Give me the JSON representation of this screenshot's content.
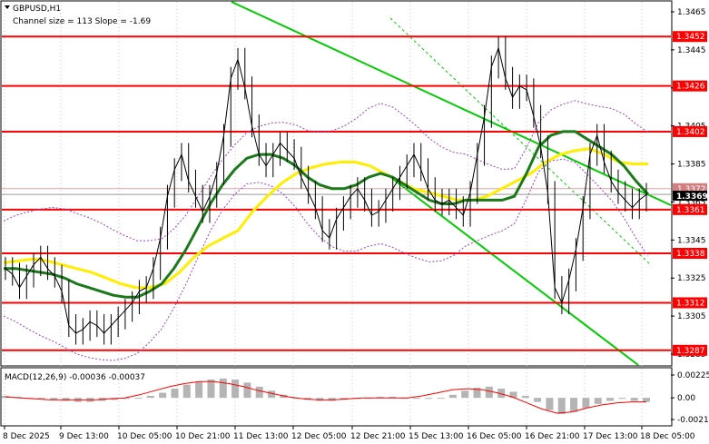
{
  "chart_data": [
    {
      "type": "line",
      "symbol": "GBPUSD,H1",
      "channel_info": "Channel size = 113 Slope = -1.69",
      "ylim": [
        1.3285,
        1.347
      ],
      "y_ticks": [
        "1.3465",
        "1.3445",
        "1.3425",
        "1.3405",
        "1.3385",
        "1.3365",
        "1.3345",
        "1.3325",
        "1.3305",
        "1.3285"
      ],
      "x_labels": [
        "8 Dec 2025",
        "9 Dec 13:00",
        "10 Dec 05:00",
        "10 Dec 21:00",
        "11 Dec 13:00",
        "12 Dec 05:00",
        "12 Dec 21:00",
        "15 Dec 13:00",
        "16 Dec 05:00",
        "16 Dec 21:00",
        "17 Dec 13:00",
        "18 Dec 05:00"
      ],
      "levels": [
        {
          "value": 1.3452,
          "label": "1.3452"
        },
        {
          "value": 1.3426,
          "label": "1.3426"
        },
        {
          "value": 1.3402,
          "label": "1.3402"
        },
        {
          "value": 1.3361,
          "label": "1.3361"
        },
        {
          "value": 1.3338,
          "label": "1.3338"
        },
        {
          "value": 1.3312,
          "label": "1.3312"
        },
        {
          "value": 1.3287,
          "label": "1.3287"
        }
      ],
      "current_price": {
        "value": 1.3369,
        "label": "1.3369"
      },
      "other_price": {
        "value": 1.3372,
        "label": "1.3372"
      },
      "price_closes": [
        1.333,
        1.3327,
        1.332,
        1.3326,
        1.3332,
        1.3336,
        1.333,
        1.3326,
        1.3318,
        1.33,
        1.3296,
        1.3298,
        1.3302,
        1.33,
        1.3296,
        1.33,
        1.3304,
        1.3308,
        1.3312,
        1.3318,
        1.332,
        1.333,
        1.3346,
        1.3368,
        1.3382,
        1.339,
        1.3376,
        1.3368,
        1.336,
        1.3368,
        1.338,
        1.34,
        1.343,
        1.344,
        1.3425,
        1.3405,
        1.339,
        1.3384,
        1.339,
        1.3396,
        1.3392,
        1.3388,
        1.3378,
        1.337,
        1.3362,
        1.335,
        1.3346,
        1.3356,
        1.3362,
        1.3368,
        1.3372,
        1.3366,
        1.3358,
        1.336,
        1.3366,
        1.3372,
        1.3378,
        1.3384,
        1.339,
        1.3382,
        1.3372,
        1.3366,
        1.3364,
        1.3366,
        1.3362,
        1.3358,
        1.337,
        1.339,
        1.341,
        1.3436,
        1.3446,
        1.343,
        1.342,
        1.3426,
        1.3424,
        1.341,
        1.3394,
        1.337,
        1.332,
        1.3312,
        1.3324,
        1.334,
        1.3362,
        1.339,
        1.34,
        1.3386,
        1.3376,
        1.337,
        1.3366,
        1.3362,
        1.3366,
        1.3369
      ],
      "ma_green": [
        1.333,
        1.333,
        1.3329,
        1.3328,
        1.3327,
        1.3325,
        1.3322,
        1.332,
        1.3318,
        1.3316,
        1.3315,
        1.3315,
        1.3318,
        1.3322,
        1.333,
        1.334,
        1.3352,
        1.3364,
        1.3374,
        1.3382,
        1.3388,
        1.339,
        1.339,
        1.3388,
        1.3384,
        1.3378,
        1.3374,
        1.3372,
        1.3372,
        1.3374,
        1.3378,
        1.338,
        1.3378,
        1.3374,
        1.337,
        1.3366,
        1.3364,
        1.3364,
        1.3366,
        1.3366,
        1.3366,
        1.3366,
        1.3368,
        1.338,
        1.3394,
        1.34,
        1.3402,
        1.3402,
        1.3398,
        1.3394,
        1.339,
        1.3384,
        1.3376,
        1.3369
      ],
      "ma_yellow": [
        1.3333,
        1.3334,
        1.3335,
        1.3334,
        1.3332,
        1.333,
        1.3328,
        1.3325,
        1.3322,
        1.332,
        1.332,
        1.3322,
        1.3328,
        1.3336,
        1.3342,
        1.3346,
        1.335,
        1.336,
        1.3368,
        1.3375,
        1.338,
        1.3383,
        1.3385,
        1.3386,
        1.3386,
        1.3384,
        1.338,
        1.3376,
        1.3372,
        1.337,
        1.3368,
        1.3366,
        1.3366,
        1.3368,
        1.3372,
        1.3376,
        1.338,
        1.3386,
        1.339,
        1.3392,
        1.3393,
        1.339,
        1.3386,
        1.3385,
        1.3385
      ],
      "colors": {
        "levels": "#ff0000",
        "channel": "#00cc00",
        "ma_green": "#1a7a1a",
        "ma_yellow": "#ffee00",
        "bollinger": "#a040c0",
        "price": "#000000"
      }
    },
    {
      "type": "bar",
      "indicator": "MACD(12,26,9) -0.00036 -0.00037",
      "y_ticks": [
        "0.00225",
        "0.00",
        "-0.00213"
      ],
      "ylim": [
        -0.00213,
        0.00225
      ],
      "histogram": [
        0.0002,
        0.0001,
        0.0,
        -0.0001,
        -0.0002,
        -0.0003,
        -0.0004,
        -0.0004,
        -0.0003,
        -0.0002,
        -0.0001,
        0.0,
        0.0002,
        0.0005,
        0.0009,
        0.0013,
        0.0016,
        0.0018,
        0.0019,
        0.0018,
        0.0015,
        0.0011,
        0.0007,
        0.0003,
        0.0,
        -0.0002,
        -0.0003,
        -0.0003,
        -0.0002,
        -0.0001,
        0.0,
        0.0001,
        0.0001,
        0.0,
        -0.0001,
        -0.0001,
        0.0,
        0.0003,
        0.0007,
        0.001,
        0.0011,
        0.0009,
        0.0006,
        0.0002,
        -0.0004,
        -0.0012,
        -0.0016,
        -0.0014,
        -0.001,
        -0.0006,
        -0.0003,
        -0.0001,
        -0.0003,
        -0.0004
      ],
      "signal": [
        0.0001,
        0.0,
        -0.0001,
        -0.0002,
        -0.0002,
        -0.0002,
        -0.0002,
        -0.0001,
        0.0,
        0.0003,
        0.0007,
        0.0011,
        0.0014,
        0.0016,
        0.0016,
        0.0014,
        0.0011,
        0.0007,
        0.0004,
        0.0001,
        -0.0001,
        -0.0002,
        -0.0002,
        -0.0001,
        0.0,
        0.0,
        0.0,
        0.0,
        0.0002,
        0.0005,
        0.0008,
        0.0009,
        0.0008,
        0.0005,
        0.0001,
        -0.0005,
        -0.0011,
        -0.0015,
        -0.0014,
        -0.001,
        -0.0007,
        -0.0005,
        -0.0004,
        -0.0004
      ],
      "colors": {
        "histogram": "#b4b4b4",
        "signal": "#ff0000"
      }
    }
  ]
}
